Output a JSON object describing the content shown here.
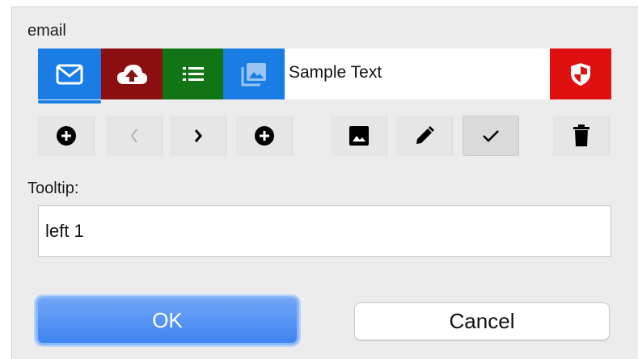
{
  "email_label": "email",
  "segments": [
    {
      "icon": "mail-icon",
      "color": "#1a7de6"
    },
    {
      "icon": "cloud-upload-icon",
      "color": "#8b0f10"
    },
    {
      "icon": "list-icon",
      "color": "#127515"
    },
    {
      "icon": "photo-library-icon",
      "color": "#1a7de6"
    }
  ],
  "segment_text": "Sample Text",
  "shield_segment": {
    "icon": "shield-icon",
    "color": "#e01010"
  },
  "toolbar": [
    {
      "icon": "add-circle-icon"
    },
    {
      "icon": "chevron-left-icon",
      "disabled": true
    },
    {
      "icon": "chevron-right-icon"
    },
    {
      "icon": "add-circle-icon"
    },
    {
      "icon": "image-icon"
    },
    {
      "icon": "pencil-icon"
    },
    {
      "icon": "checkmark-icon",
      "pressed": true
    },
    {
      "icon": "trash-icon"
    }
  ],
  "tooltip_label": "Tooltip:",
  "tooltip_value": "left 1",
  "ok_label": "OK",
  "cancel_label": "Cancel"
}
